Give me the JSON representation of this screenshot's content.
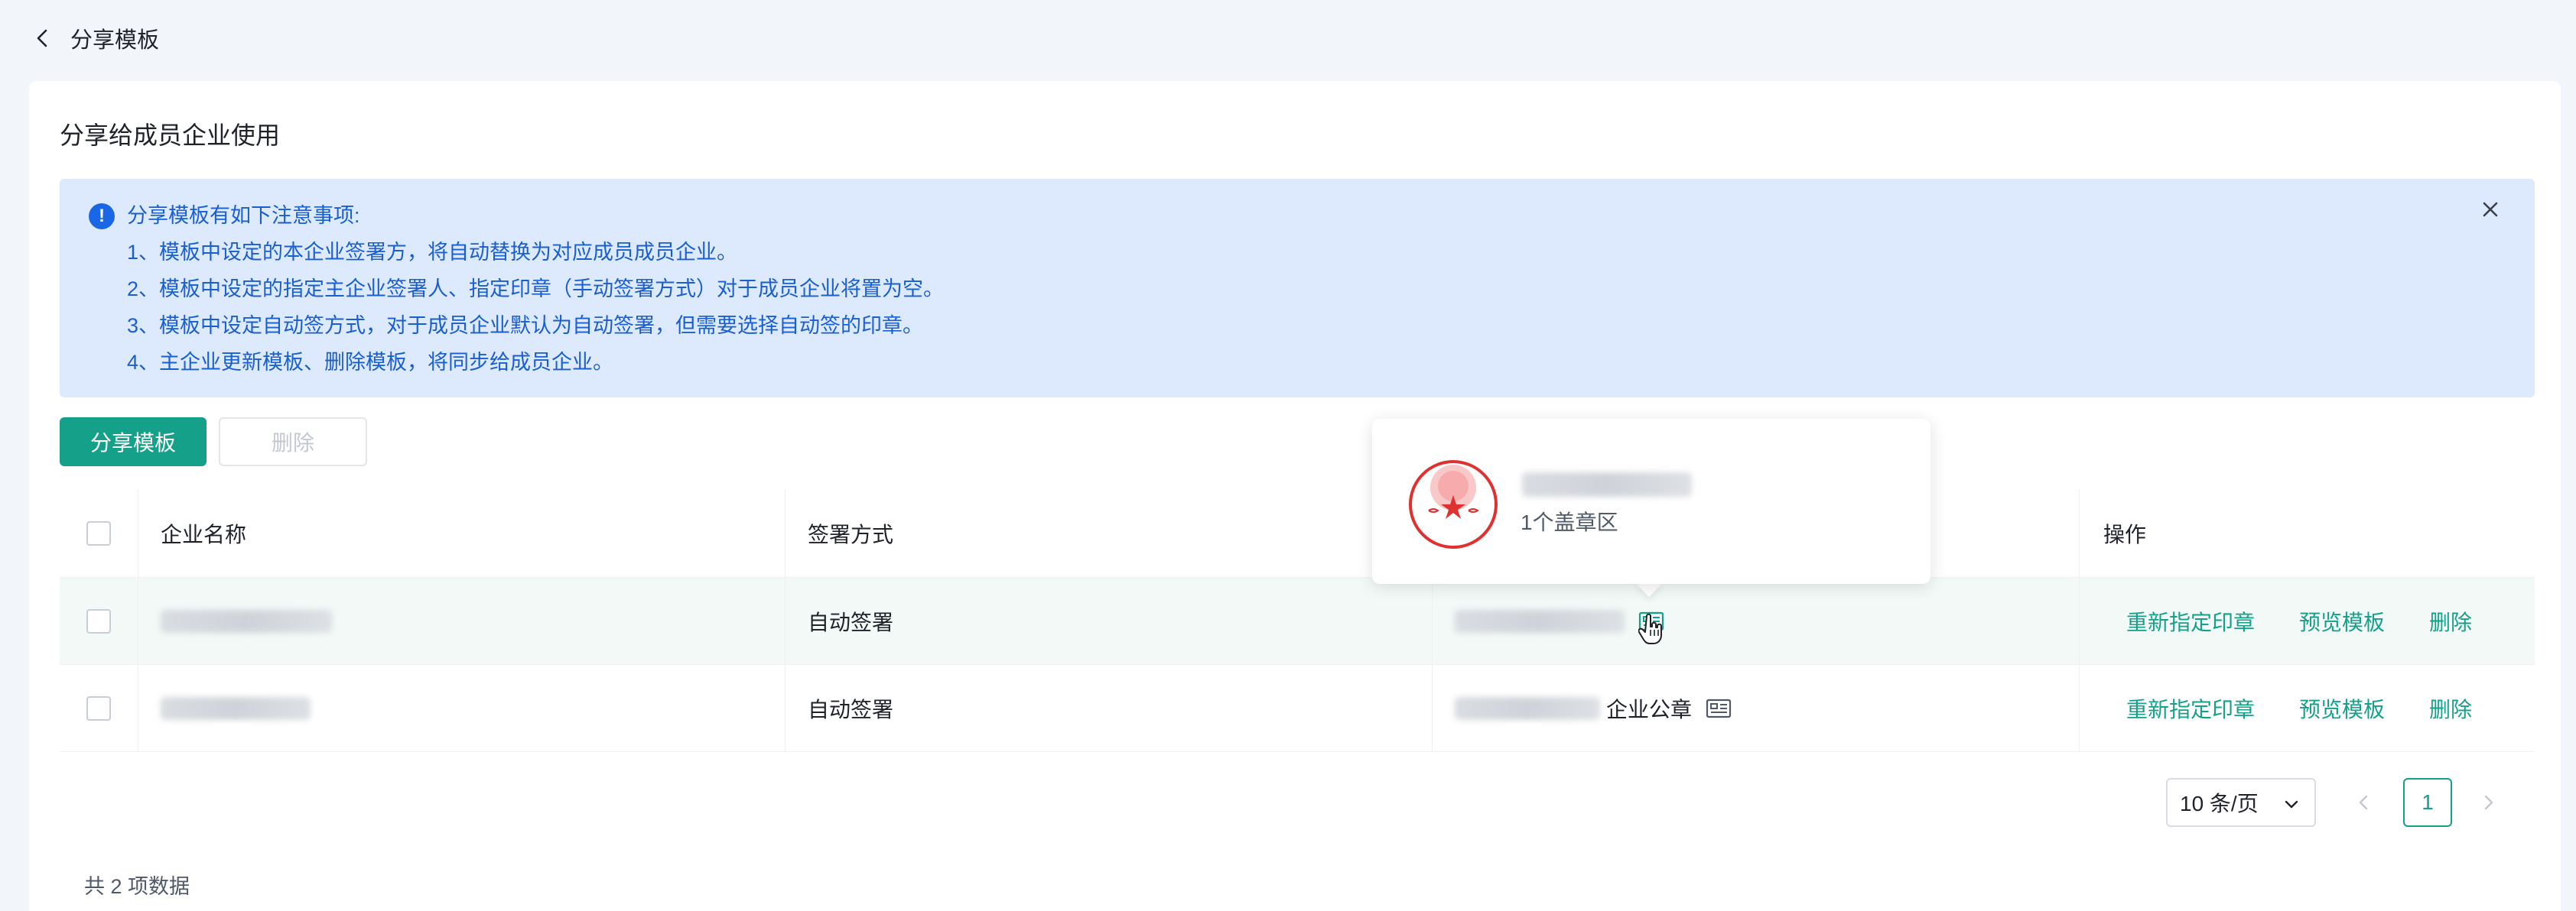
{
  "header": {
    "back_title": "分享模板"
  },
  "section": {
    "title": "分享给成员企业使用"
  },
  "notice": {
    "heading": "分享模板有如下注意事项:",
    "items": [
      "1、模板中设定的本企业签署方，将自动替换为对应成员成员企业。",
      "2、模板中设定的指定主企业签署人、指定印章（手动签署方式）对于成员企业将置为空。",
      "3、模板中设定自动签方式，对于成员企业默认为自动签署，但需要选择自动签的印章。",
      "4、主企业更新模板、删除模板，将同步给成员企业。"
    ]
  },
  "toolbar": {
    "share_label": "分享模板",
    "delete_label": "删除"
  },
  "table": {
    "columns": [
      "企业名称",
      "签署方式",
      "",
      "操作"
    ],
    "rows": [
      {
        "method": "自动签署",
        "seal_name": "",
        "ops": [
          "重新指定印章",
          "预览模板",
          "删除"
        ]
      },
      {
        "method": "自动签署",
        "seal_name": "企业公章",
        "ops": [
          "重新指定印章",
          "预览模板",
          "删除"
        ]
      }
    ]
  },
  "popover": {
    "subtitle": "1个盖章区"
  },
  "pagination": {
    "total_text": "共 2 项数据",
    "page_size": "10 条/页",
    "current_page": "1"
  },
  "colors": {
    "accent": "#15a08a",
    "notice_bg": "#dde9fd",
    "notice_text": "#1a5fcf",
    "seal_red": "#e03131"
  }
}
